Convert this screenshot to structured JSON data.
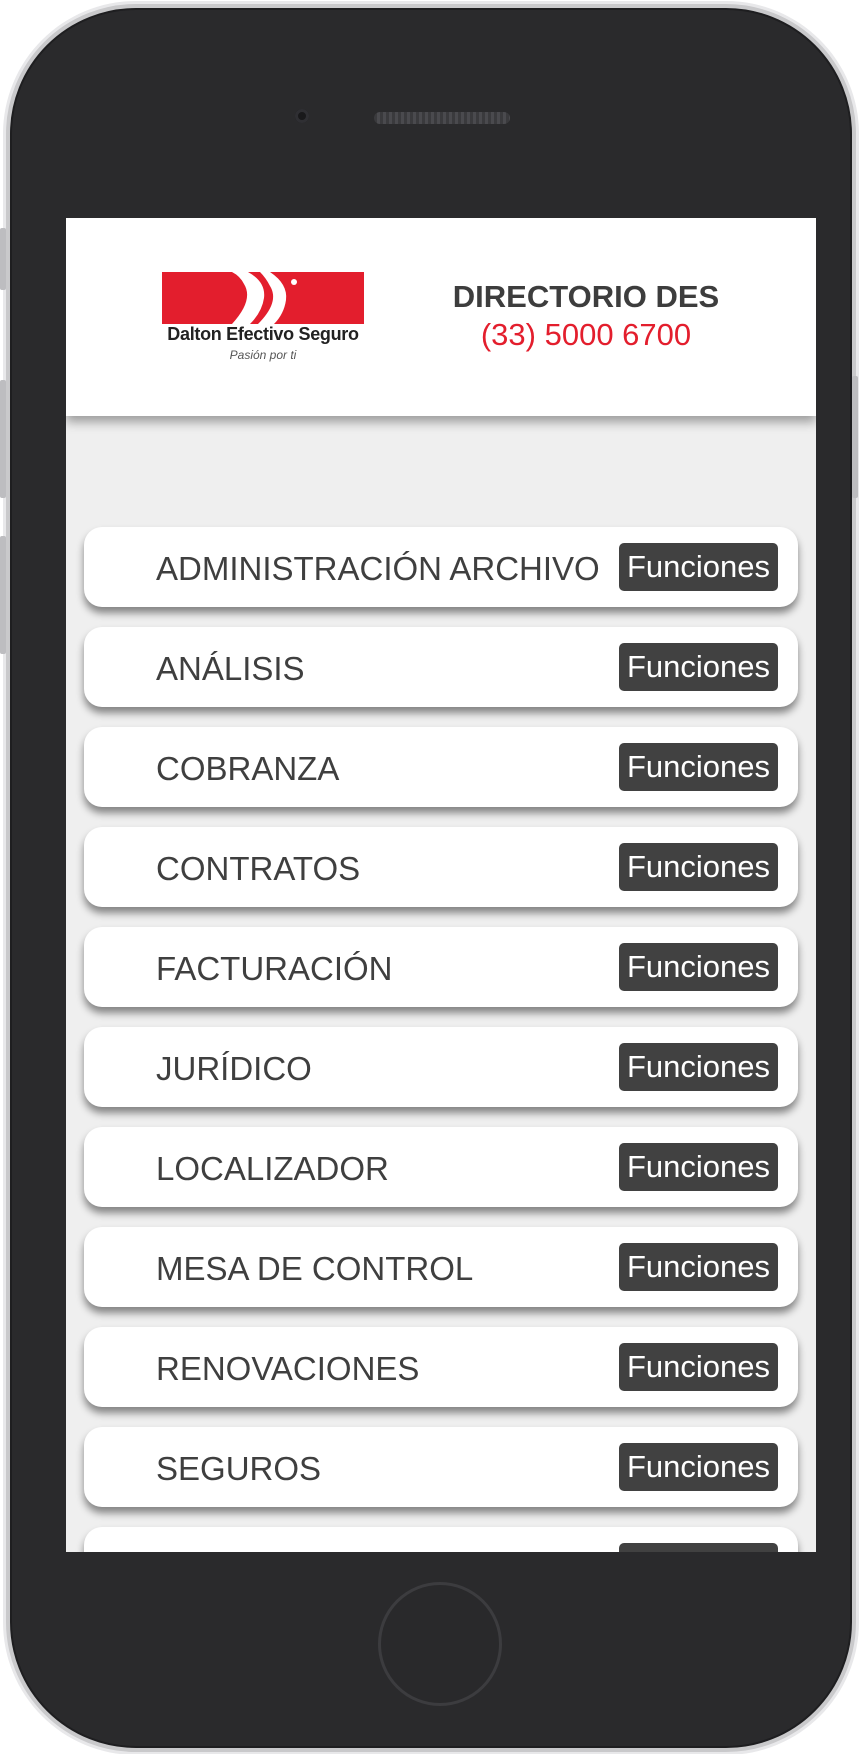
{
  "header": {
    "logo": {
      "brand": "Dalton Efectivo Seguro",
      "tagline": "Pasión por ti"
    },
    "directory_title": "DIRECTORIO DES",
    "directory_phone": "(33) 5000 6700"
  },
  "departments": {
    "button_label": "Funciones",
    "items": [
      {
        "label": "ADMINISTRACIÓN ARCHIVO"
      },
      {
        "label": "ANÁLISIS"
      },
      {
        "label": "COBRANZA"
      },
      {
        "label": "CONTRATOS"
      },
      {
        "label": "FACTURACIÓN"
      },
      {
        "label": "JURÍDICO"
      },
      {
        "label": "LOCALIZADOR"
      },
      {
        "label": "MESA DE CONTROL"
      },
      {
        "label": "RENOVACIONES"
      },
      {
        "label": "SEGUROS"
      },
      {
        "label": ""
      }
    ]
  },
  "colors": {
    "brand_red": "#e31e2d",
    "button_bg": "#414141",
    "page_bg": "#efefef"
  }
}
